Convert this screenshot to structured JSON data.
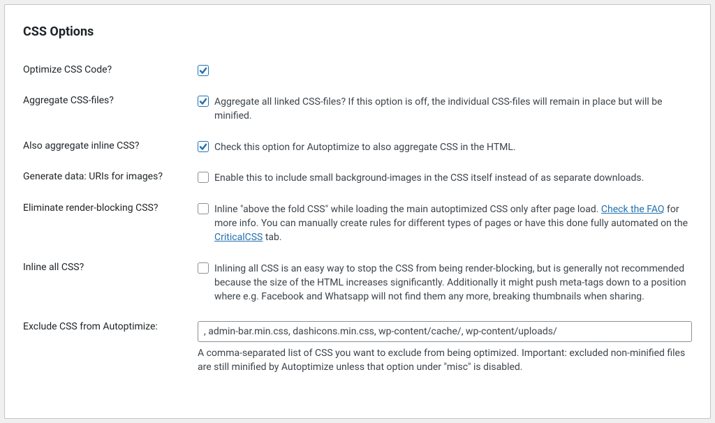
{
  "section_title": "CSS Options",
  "rows": {
    "optimize_css": {
      "label": "Optimize CSS Code?",
      "checked": true,
      "desc": ""
    },
    "aggregate_css": {
      "label": "Aggregate CSS-files?",
      "checked": true,
      "desc": "Aggregate all linked CSS-files? If this option is off, the individual CSS-files will remain in place but will be minified."
    },
    "aggregate_inline": {
      "label": "Also aggregate inline CSS?",
      "checked": true,
      "desc": "Check this option for Autoptimize to also aggregate CSS in the HTML."
    },
    "data_uris": {
      "label": "Generate data: URIs for images?",
      "checked": false,
      "desc": "Enable this to include small background-images in the CSS itself instead of as separate downloads."
    },
    "render_blocking": {
      "label": "Eliminate render-blocking CSS?",
      "checked": false,
      "desc_1": "Inline \"above the fold CSS\" while loading the main autoptimized CSS only after page load. ",
      "link_1": "Check the FAQ",
      "desc_2": " for more info. You can manually create rules for different types of pages or have this done fully automated on the ",
      "link_2": "CriticalCSS",
      "desc_3": " tab."
    },
    "inline_all": {
      "label": "Inline all CSS?",
      "checked": false,
      "desc": "Inlining all CSS is an easy way to stop the CSS from being render-blocking, but is generally not recommended because the size of the HTML increases significantly. Additionally it might push meta-tags down to a position where e.g. Facebook and Whatsapp will not find them any more, breaking thumbnails when sharing."
    },
    "exclude": {
      "label": "Exclude CSS from Autoptimize:",
      "value": ", admin-bar.min.css, dashicons.min.css, wp-content/cache/, wp-content/uploads/",
      "help": "A comma-separated list of CSS you want to exclude from being optimized. Important: excluded non-minified files are still minified by Autoptimize unless that option under \"misc\" is disabled."
    }
  }
}
